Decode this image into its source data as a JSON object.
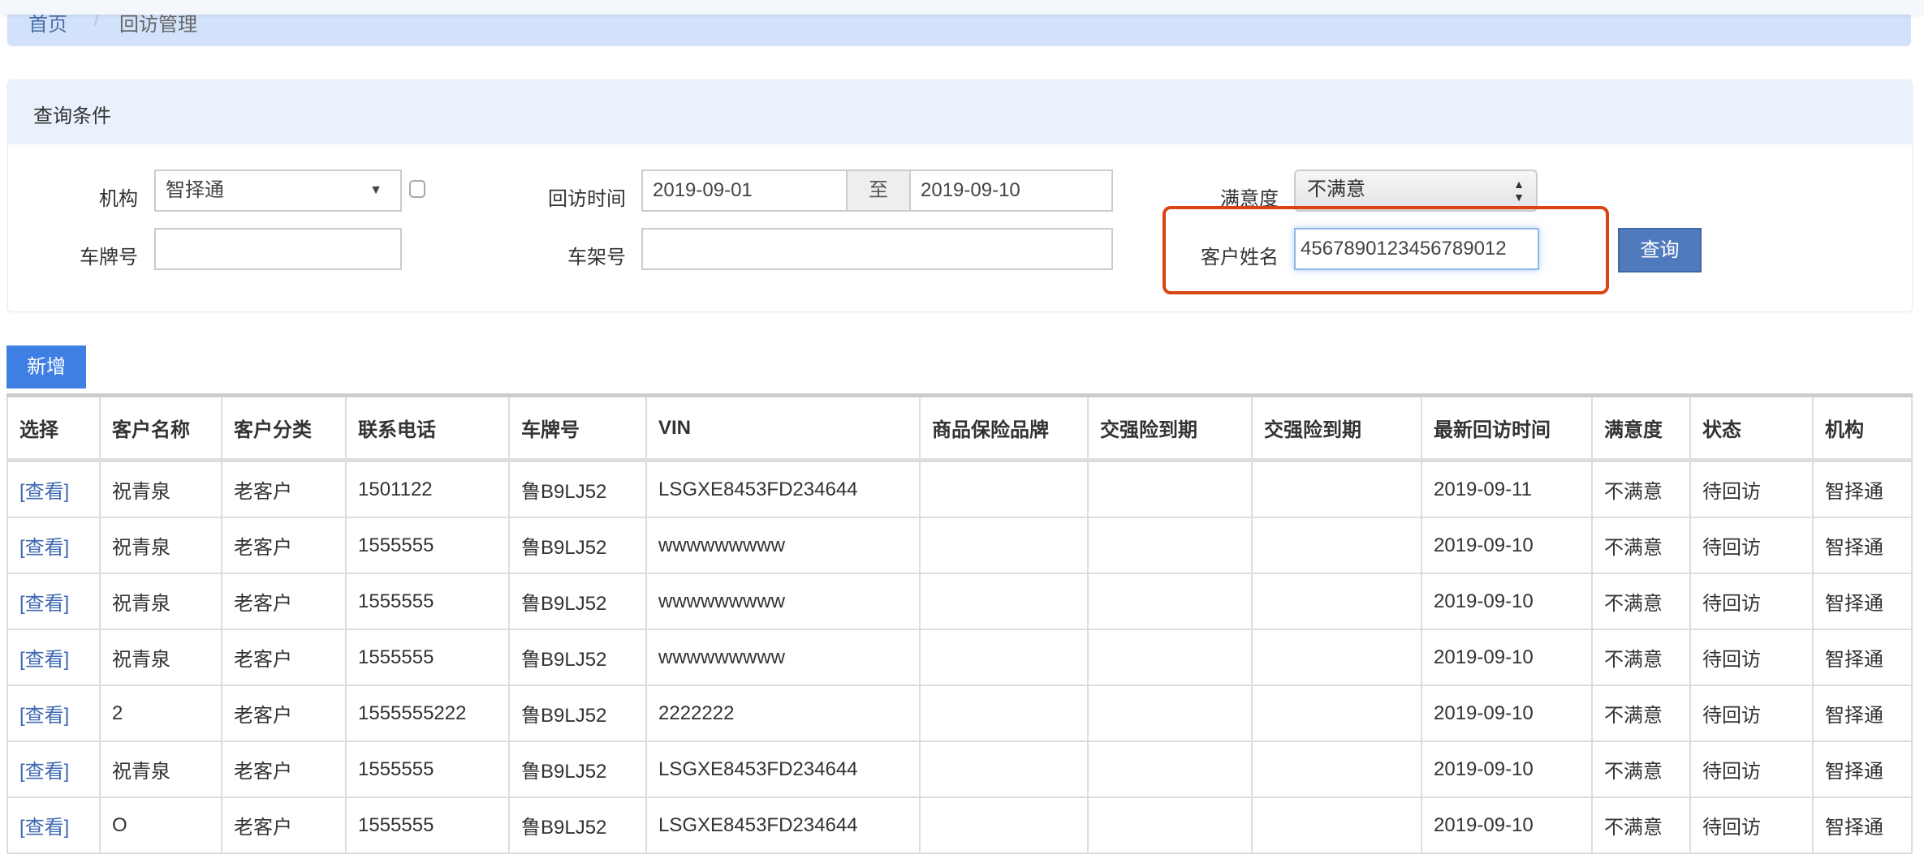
{
  "breadcrumb": {
    "home": "首页",
    "separator": "/",
    "current": "回访管理"
  },
  "query_panel": {
    "title": "查询条件",
    "org": {
      "label": "机构",
      "value": "智择通"
    },
    "visit_time": {
      "label": "回访时间",
      "from": "2019-09-01",
      "to_label": "至",
      "to": "2019-09-10"
    },
    "satisfaction": {
      "label": "满意度",
      "value": "不满意"
    },
    "plate": {
      "label": "车牌号",
      "value": ""
    },
    "frame": {
      "label": "车架号",
      "value": ""
    },
    "customer_name": {
      "label": "客户姓名",
      "value": "4567890123456789012"
    },
    "search_button": "查询"
  },
  "add_button": "新增",
  "table": {
    "headers": [
      "选择",
      "客户名称",
      "客户分类",
      "联系电话",
      "车牌号",
      "VIN",
      "商品保险品牌",
      "交强险到期",
      "交强险到期",
      "最新回访时间",
      "满意度",
      "状态",
      "机构"
    ],
    "rows": [
      [
        "[查看]",
        "祝青泉",
        "老客户",
        "1501122",
        "鲁B9LJ52",
        "LSGXE8453FD234644",
        "",
        "",
        "",
        "2019-09-11",
        "不满意",
        "待回访",
        "智择通"
      ],
      [
        "[查看]",
        "祝青泉",
        "老客户",
        "1555555",
        "鲁B9LJ52",
        "wwwwwwwww",
        "",
        "",
        "",
        "2019-09-10",
        "不满意",
        "待回访",
        "智择通"
      ],
      [
        "[查看]",
        "祝青泉",
        "老客户",
        "1555555",
        "鲁B9LJ52",
        "wwwwwwwww",
        "",
        "",
        "",
        "2019-09-10",
        "不满意",
        "待回访",
        "智择通"
      ],
      [
        "[查看]",
        "祝青泉",
        "老客户",
        "1555555",
        "鲁B9LJ52",
        "wwwwwwwww",
        "",
        "",
        "",
        "2019-09-10",
        "不满意",
        "待回访",
        "智择通"
      ],
      [
        "[查看]",
        "2",
        "老客户",
        "1555555222",
        "鲁B9LJ52",
        "2222222",
        "",
        "",
        "",
        "2019-09-10",
        "不满意",
        "待回访",
        "智择通"
      ],
      [
        "[查看]",
        "祝青泉",
        "老客户",
        "1555555",
        "鲁B9LJ52",
        "LSGXE8453FD234644",
        "",
        "",
        "",
        "2019-09-10",
        "不满意",
        "待回访",
        "智择通"
      ],
      [
        "[查看]",
        "O",
        "老客户",
        "1555555",
        "鲁B9LJ52",
        "LSGXE8453FD234644",
        "",
        "",
        "",
        "2019-09-10",
        "不满意",
        "待回访",
        "智择通"
      ]
    ]
  }
}
